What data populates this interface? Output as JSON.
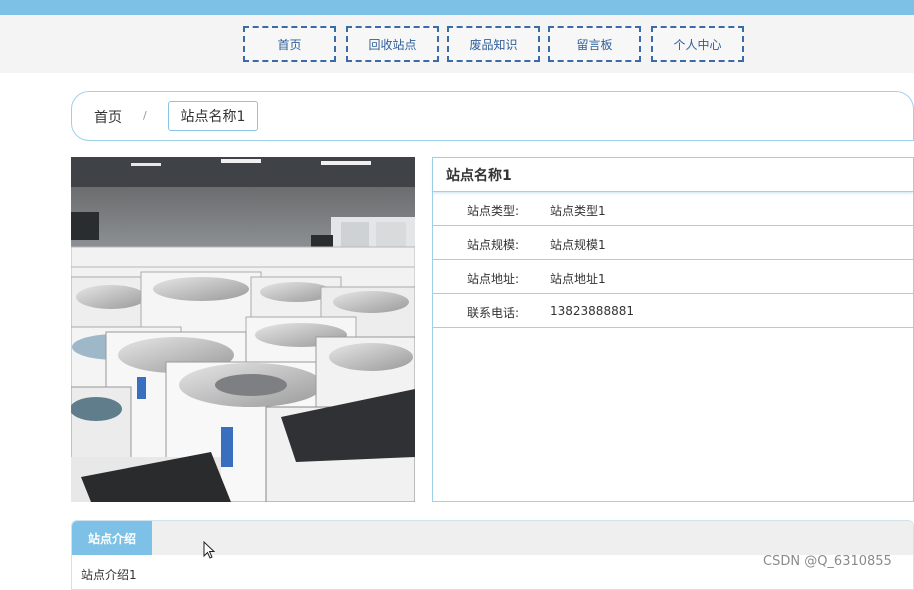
{
  "nav": {
    "items": [
      {
        "label": "首页"
      },
      {
        "label": "回收站点"
      },
      {
        "label": "废品知识"
      },
      {
        "label": "留言板"
      },
      {
        "label": "个人中心"
      }
    ]
  },
  "breadcrumb": {
    "home": "首页",
    "separator": "/",
    "current": "站点名称1"
  },
  "station": {
    "name": "站点名称1",
    "fields": [
      {
        "label": "站点类型:",
        "value": "站点类型1"
      },
      {
        "label": "站点规模:",
        "value": "站点规模1"
      },
      {
        "label": "站点地址:",
        "value": "站点地址1"
      },
      {
        "label": "联系电话:",
        "value": "13823888881"
      }
    ]
  },
  "tabs": {
    "active_label": "站点介绍",
    "content": "站点介绍1"
  },
  "watermark": "CSDN @Q_6310855",
  "colors": {
    "accent": "#7ec1e6",
    "border": "#9fd0ea",
    "nav_border": "#3b6aa8"
  }
}
